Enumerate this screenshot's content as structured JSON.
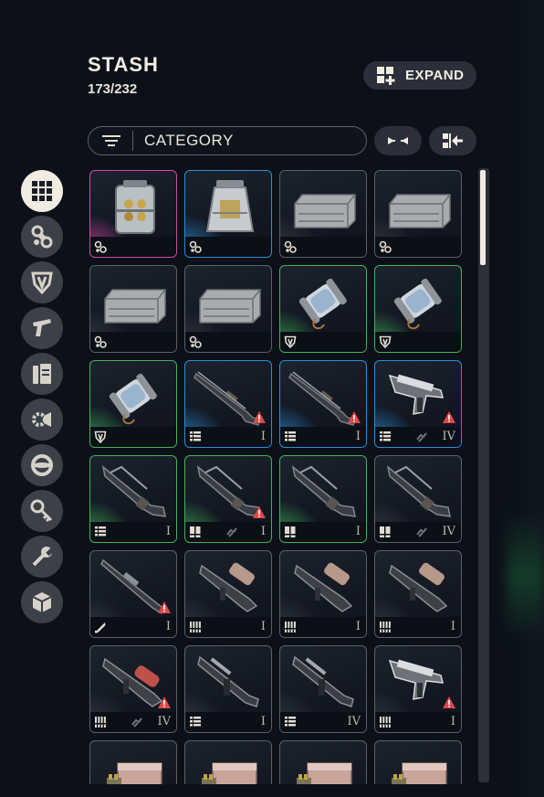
{
  "header": {
    "title": "STASH",
    "count": "173/232",
    "expand_label": "EXPAND"
  },
  "filter": {
    "label": "CATEGORY",
    "filter_icon": "filter-lines-icon",
    "collapse_icon": "collapse-arrows-icon",
    "sort_icon": "sort-left-icon"
  },
  "sidebar": {
    "items": [
      {
        "icon": "grid-icon",
        "active": true
      },
      {
        "icon": "chain-links-icon",
        "active": false
      },
      {
        "icon": "shield-armor-icon",
        "active": false
      },
      {
        "icon": "pistol-icon",
        "active": false
      },
      {
        "icon": "ammo-magazine-icon",
        "active": false
      },
      {
        "icon": "gear-parts-icon",
        "active": false
      },
      {
        "icon": "ring-icon",
        "active": false
      },
      {
        "icon": "key-icon",
        "active": false
      },
      {
        "icon": "wrench-icon",
        "active": false
      },
      {
        "icon": "cube-icon",
        "active": false
      }
    ]
  },
  "colors": {
    "pink": "#d34aa2",
    "blue": "#2a8ed6",
    "green": "#3fb457",
    "grey": "#5a5f68",
    "warning": "#e04848"
  },
  "items": [
    {
      "art": "case",
      "rarity": "pink",
      "type": "chain-links-icon",
      "tier": "",
      "warn": false,
      "mid": false
    },
    {
      "art": "pyramid-case",
      "rarity": "blue",
      "type": "chain-links-icon",
      "tier": "",
      "warn": false,
      "mid": false
    },
    {
      "art": "crate",
      "rarity": "grey",
      "type": "chain-links-icon",
      "tier": "",
      "warn": false,
      "mid": false
    },
    {
      "art": "crate",
      "rarity": "grey",
      "type": "chain-links-icon",
      "tier": "",
      "warn": false,
      "mid": false
    },
    {
      "art": "crate",
      "rarity": "grey",
      "type": "chain-links-icon",
      "tier": "",
      "warn": false,
      "mid": false
    },
    {
      "art": "crate",
      "rarity": "grey",
      "type": "chain-links-icon",
      "tier": "",
      "warn": false,
      "mid": false
    },
    {
      "art": "canister",
      "rarity": "green",
      "type": "shield-armor-icon",
      "tier": "",
      "warn": false,
      "mid": false
    },
    {
      "art": "canister",
      "rarity": "green",
      "type": "shield-armor-icon",
      "tier": "",
      "warn": false,
      "mid": false
    },
    {
      "art": "canister",
      "rarity": "green",
      "type": "shield-armor-icon",
      "tier": "",
      "warn": false,
      "mid": false
    },
    {
      "art": "shotgun",
      "rarity": "blue",
      "type": "list-magazine-icon",
      "tier": "I",
      "warn": true,
      "mid": false
    },
    {
      "art": "shotgun",
      "rarity": "blue",
      "type": "list-magazine-icon",
      "tier": "I",
      "warn": true,
      "mid": false
    },
    {
      "art": "pistol",
      "rarity": "blue",
      "type": "list-magazine-icon",
      "tier": "IV",
      "warn": true,
      "mid": true
    },
    {
      "art": "rifle",
      "rarity": "green",
      "type": "list-magazine-icon",
      "tier": "I",
      "warn": false,
      "mid": false
    },
    {
      "art": "rifle",
      "rarity": "green",
      "type": "double-magazine-icon",
      "tier": "I",
      "warn": true,
      "mid": true
    },
    {
      "art": "rifle",
      "rarity": "green",
      "type": "double-magazine-icon",
      "tier": "I",
      "warn": false,
      "mid": false
    },
    {
      "art": "rifle",
      "rarity": "grey",
      "type": "double-magazine-icon",
      "tier": "IV",
      "warn": false,
      "mid": true
    },
    {
      "art": "sniper",
      "rarity": "grey",
      "type": "bullet-icon",
      "tier": "I",
      "warn": true,
      "mid": false
    },
    {
      "art": "smg",
      "rarity": "grey",
      "type": "belt-icon",
      "tier": "I",
      "warn": false,
      "mid": false
    },
    {
      "art": "smg",
      "rarity": "grey",
      "type": "belt-icon",
      "tier": "I",
      "warn": false,
      "mid": false
    },
    {
      "art": "smg",
      "rarity": "grey",
      "type": "belt-icon",
      "tier": "I",
      "warn": false,
      "mid": false
    },
    {
      "art": "smg-red",
      "rarity": "grey",
      "type": "belt-icon",
      "tier": "IV",
      "warn": true,
      "mid": true
    },
    {
      "art": "carbine",
      "rarity": "grey",
      "type": "list-magazine-icon",
      "tier": "I",
      "warn": false,
      "mid": false
    },
    {
      "art": "carbine",
      "rarity": "grey",
      "type": "list-magazine-icon",
      "tier": "IV",
      "warn": false,
      "mid": false
    },
    {
      "art": "pistol",
      "rarity": "grey",
      "type": "belt-icon",
      "tier": "I",
      "warn": true,
      "mid": false
    },
    {
      "art": "ammo-box",
      "rarity": "grey",
      "type": "",
      "tier": "",
      "warn": false,
      "mid": false
    },
    {
      "art": "ammo-box",
      "rarity": "grey",
      "type": "",
      "tier": "",
      "warn": false,
      "mid": false
    },
    {
      "art": "ammo-box",
      "rarity": "grey",
      "type": "",
      "tier": "",
      "warn": false,
      "mid": false
    },
    {
      "art": "ammo-box",
      "rarity": "grey",
      "type": "",
      "tier": "",
      "warn": false,
      "mid": false
    }
  ],
  "scrollbar": {
    "position": 0
  }
}
